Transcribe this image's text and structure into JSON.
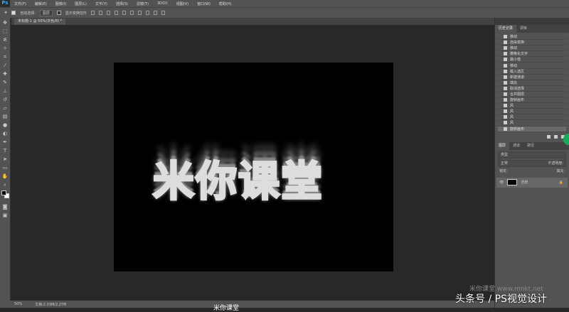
{
  "app": {
    "logo": "Ps"
  },
  "menu": [
    "文件(F)",
    "编辑(E)",
    "图像(I)",
    "图层(L)",
    "文字(Y)",
    "选择(S)",
    "滤镜(T)",
    "3D(D)",
    "视图(V)",
    "窗口(W)",
    "帮助(H)"
  ],
  "options": {
    "auto_select": "自动选择:",
    "auto_select_value": "图层",
    "show_transform": "显示变换控件"
  },
  "document": {
    "tab_title": "未标题-1 @ 50%(灰色/8) *",
    "canvas_text": "米你课堂"
  },
  "status": {
    "zoom": "50%",
    "doc_size": "文档:2.03M/2.27M"
  },
  "history_panel": {
    "tabs": [
      "历史记录",
      "调板"
    ],
    "items": [
      "移动",
      "自由变换",
      "移动",
      "栅格化文字",
      "最小值",
      "移动",
      "载入选区",
      "新建通道",
      "填充",
      "取消选择",
      "合并图层",
      "旋转画布",
      "风",
      "风",
      "风",
      "风",
      "旋转画布"
    ]
  },
  "layers_panel": {
    "tabs": [
      "图层",
      "通道",
      "路径"
    ],
    "kind": "类型",
    "mode": "正常",
    "opacity_label": "不透明度:",
    "lock_label": "锁定:",
    "fill_label": "填充:",
    "layer_name": "背景"
  },
  "watermark": {
    "main": "头条号 / PS视觉设计",
    "site": "米你课堂 www.mnkt.net",
    "bottom": "米你课堂"
  }
}
